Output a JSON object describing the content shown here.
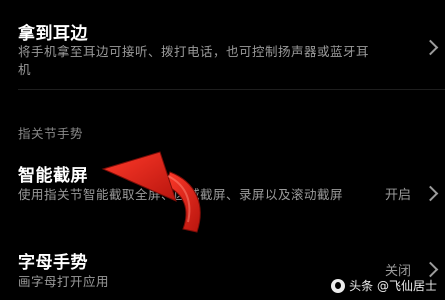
{
  "rows": {
    "ear": {
      "title": "拿到耳边",
      "desc": "将手机拿至耳边可接听、拨打电话，也可控制扬声器或蓝牙耳机"
    },
    "section_header": "指关节手势",
    "smart_screenshot": {
      "title": "智能截屏",
      "desc": "使用指关节智能截取全屏、区域截屏、录屏以及滚动截屏",
      "value": "开启"
    },
    "letter_gesture": {
      "title": "字母手势",
      "desc": "画字母打开应用",
      "value": "关闭"
    }
  },
  "watermark": {
    "text": "头条 @飞仙居士"
  },
  "colors": {
    "background": "#000000",
    "title": "#ffffff",
    "secondary": "#9a9a9a",
    "arrow": "#e0231a"
  },
  "icons": {
    "chevron": "chevron-right-icon",
    "annotation": "curved-arrow-icon"
  }
}
